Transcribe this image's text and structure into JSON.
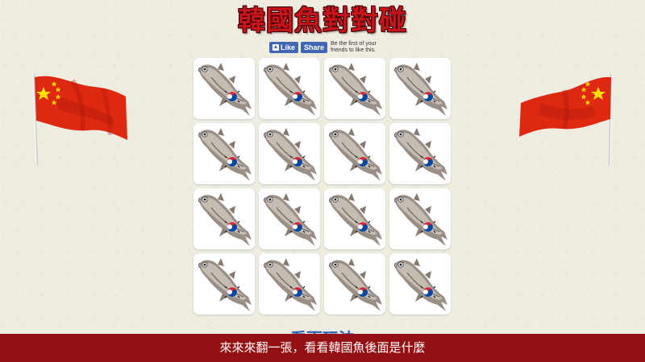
{
  "title": "韓國魚對對碰",
  "facebook": {
    "like_label": "Like",
    "share_label": "Share",
    "social_text": "Be the first of your friends to like this."
  },
  "cards": [
    {
      "state": "face-down",
      "icon": "korean-fish-icon"
    },
    {
      "state": "face-down",
      "icon": "korean-fish-icon"
    },
    {
      "state": "face-down",
      "icon": "korean-fish-icon"
    },
    {
      "state": "face-down",
      "icon": "korean-fish-icon"
    },
    {
      "state": "face-down",
      "icon": "korean-fish-icon"
    },
    {
      "state": "face-down",
      "icon": "korean-fish-icon"
    },
    {
      "state": "face-down",
      "icon": "korean-fish-icon"
    },
    {
      "state": "face-down",
      "icon": "korean-fish-icon"
    },
    {
      "state": "face-down",
      "icon": "korean-fish-icon"
    },
    {
      "state": "face-down",
      "icon": "korean-fish-icon"
    },
    {
      "state": "face-down",
      "icon": "korean-fish-icon"
    },
    {
      "state": "face-down",
      "icon": "korean-fish-icon"
    },
    {
      "state": "face-down",
      "icon": "korean-fish-icon"
    },
    {
      "state": "face-down",
      "icon": "korean-fish-icon"
    },
    {
      "state": "face-down",
      "icon": "korean-fish-icon"
    },
    {
      "state": "face-down",
      "icon": "korean-fish-icon"
    }
  ],
  "subheading": "看更玩法",
  "footer": "來來來翻一張，看看韓國魚後面是什麼",
  "colors": {
    "title_red": "#c8141b",
    "footer_bg": "#930f12",
    "flag_red": "#de2910",
    "flag_star": "#ffde00",
    "fb_blue": "#4267b2"
  }
}
